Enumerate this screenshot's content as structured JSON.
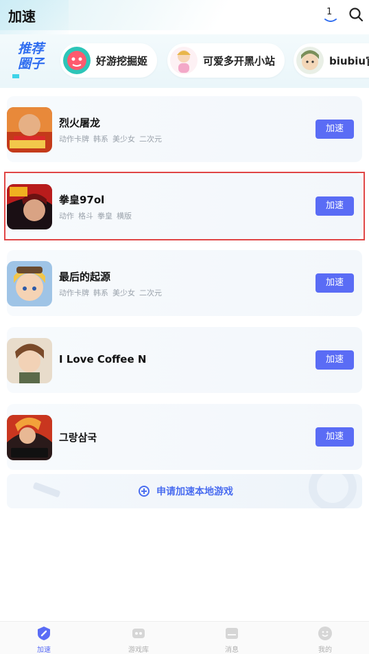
{
  "header": {
    "title": "加速",
    "download_count": "1"
  },
  "circles": {
    "logo_line1": "推荐",
    "logo_line2": "圈子",
    "items": [
      {
        "label": "好游挖掘姬"
      },
      {
        "label": "可爱多开黑小站"
      },
      {
        "label": "biubiu官"
      }
    ]
  },
  "games": [
    {
      "name": "烈火屠龙",
      "tags": [
        "动作卡牌",
        "韩系",
        "美少女",
        "二次元"
      ],
      "button": "加速"
    },
    {
      "name": "拳皇97ol",
      "tags": [
        "动作",
        "格斗",
        "拳皇",
        "横版"
      ],
      "button": "加速"
    },
    {
      "name": "最后的起源",
      "tags": [
        "动作卡牌",
        "韩系",
        "美少女",
        "二次元"
      ],
      "button": "加速"
    },
    {
      "name": "I Love Coffee N",
      "tags": [],
      "button": "加速"
    },
    {
      "name": "그랑삼국",
      "tags": [],
      "button": "加速"
    }
  ],
  "apply": {
    "label": "申请加速本地游戏"
  },
  "bottom_nav": [
    {
      "label": "加速",
      "active": true
    },
    {
      "label": "游戏库",
      "active": false
    },
    {
      "label": "消息",
      "active": false
    },
    {
      "label": "我的",
      "active": false
    }
  ],
  "colors": {
    "accent": "#5a6cf5",
    "link": "#4a6df0",
    "highlight_border": "#e04545"
  }
}
